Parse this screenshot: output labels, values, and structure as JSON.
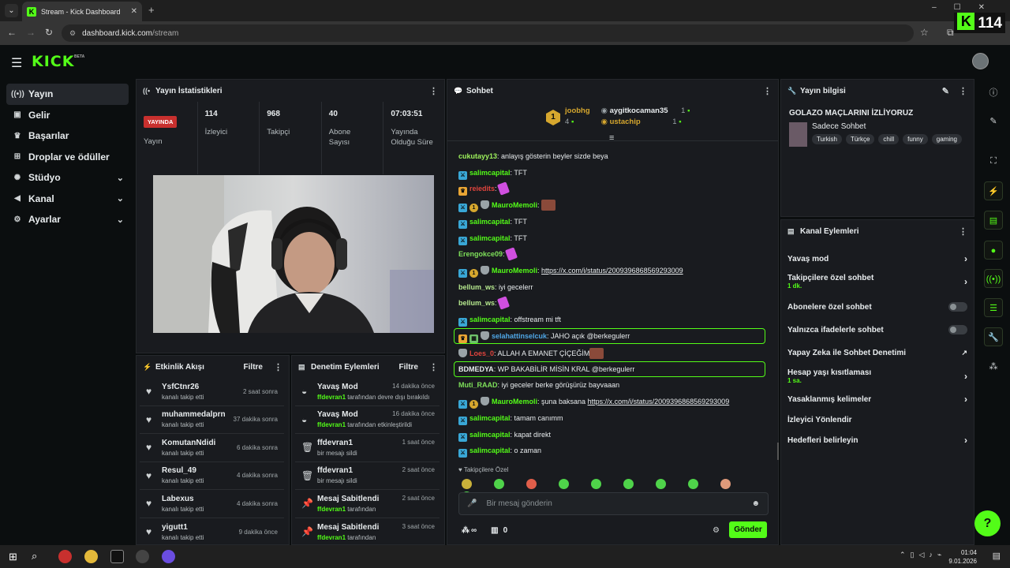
{
  "browser": {
    "tab_title": "Stream - Kick Dashboard",
    "url_host": "dashboard.kick.com",
    "url_path": "/stream",
    "viewer_overlay": "114"
  },
  "nav": {
    "items": [
      {
        "label": "Yayın",
        "icon": "broadcast-icon"
      },
      {
        "label": "Gelir",
        "icon": "wallet-icon"
      },
      {
        "label": "Başarılar",
        "icon": "trophy-icon"
      },
      {
        "label": "Droplar ve ödüller",
        "icon": "gift-icon"
      },
      {
        "label": "Stüdyo",
        "icon": "studio-icon"
      },
      {
        "label": "Kanal",
        "icon": "megaphone-icon"
      },
      {
        "label": "Ayarlar",
        "icon": "gear-icon"
      }
    ]
  },
  "stats": {
    "title": "Yayın İstatistikleri",
    "live_label": "YAYINDA",
    "live_sub": "Yayın",
    "viewers": "114",
    "viewers_label": "İzleyici",
    "followers": "968",
    "followers_label": "Takipçi",
    "subs": "40",
    "subs_label": "Abone Sayısı",
    "uptime": "07:03:51",
    "uptime_label": "Yayında Olduğu Süre"
  },
  "activity": {
    "title": "Etkinlik Akışı",
    "filter": "Filtre",
    "items": [
      {
        "name": "YsfCtnr26",
        "sub": "kanalı takip etti",
        "time": "2 saat sonra"
      },
      {
        "name": "muhammedalprn",
        "sub": "kanalı takip etti",
        "time": "37 dakika sonra"
      },
      {
        "name": "KomutanNdidi",
        "sub": "kanalı takip etti",
        "time": "6 dakika sonra"
      },
      {
        "name": "Resul_49",
        "sub": "kanalı takip etti",
        "time": "4 dakika sonra"
      },
      {
        "name": "Labexus",
        "sub": "kanalı takip etti",
        "time": "4 dakika sonra"
      },
      {
        "name": "yigutt1",
        "sub": "kanalı takip etti",
        "time": "9 dakika önce"
      }
    ]
  },
  "moderation": {
    "title": "Denetim Eylemleri",
    "filter": "Filtre",
    "items": [
      {
        "name": "Yavaş Mod",
        "actor": "ffdevran1",
        "sub": " tarafından devre dışı bırakıldı",
        "time": "14 dakika önce"
      },
      {
        "name": "Yavaş Mod",
        "actor": "ffdevran1",
        "sub": " tarafından etkinleştirildi",
        "time": "16 dakika önce"
      },
      {
        "name": "ffdevran1",
        "actor": "",
        "sub": "bir mesajı sildi",
        "time": "1 saat önce"
      },
      {
        "name": "ffdevran1",
        "actor": "",
        "sub": "bir mesajı sildi",
        "time": "2 saat önce"
      },
      {
        "name": "Mesaj Sabitlendi",
        "actor": "ffdevran1",
        "sub": " tarafından",
        "time": "2 saat önce"
      },
      {
        "name": "Mesaj Sabitlendi",
        "actor": "ffdevran1",
        "sub": " tarafından",
        "time": "3 saat önce"
      }
    ]
  },
  "chat": {
    "title": "Sohbet",
    "top_gifters": [
      {
        "name": "joobhg",
        "count": "4"
      },
      {
        "name": "aygitkocaman35",
        "count": "1"
      },
      {
        "name": "ustachip",
        "count": "1"
      }
    ],
    "top_rank": "1",
    "messages": [
      {
        "user": "cukutayy13",
        "text": ": anlayış gösterin beyler sizde beya"
      },
      {
        "user": "salimcapital",
        "text": ": TFT"
      },
      {
        "user": "reiedits",
        "text": ":"
      },
      {
        "user": "MauroMemoli",
        "text": ":"
      },
      {
        "user": "salimcapital",
        "text": ": TFT"
      },
      {
        "user": "salimcapital",
        "text": ": TFT"
      },
      {
        "user": "Erengokce09",
        "text": ":"
      },
      {
        "user": "MauroMemoli",
        "text": ": ",
        "link": "https://x.com/i/status/2009396868569293009"
      },
      {
        "user": "bellum_ws",
        "text": ": iyi gecelerr"
      },
      {
        "user": "bellum_ws",
        "text": ":"
      },
      {
        "user": "salimcapital",
        "text": ": offstream mi tft"
      },
      {
        "user": "selahattinselcuk",
        "text": ": JAHO açık @berkegulerr"
      },
      {
        "user": "Loes_0",
        "text": ": ALLAH A EMANET ÇİÇEĞİM"
      },
      {
        "user": "BDMEDYA",
        "text": ": WP BAKABİLİR MİSİN KRAL @berkegulerr"
      },
      {
        "user": "Muti_RAAD",
        "text": ": iyi geceler berke görüşürüz bayvaaan"
      },
      {
        "user": "MauroMemoli",
        "text": ": şuna baksana ",
        "link": "https://x.com/i/status/2009396868569293009"
      },
      {
        "user": "salimcapital",
        "text": ": tamam canımm"
      },
      {
        "user": "salimcapital",
        "text": ": kapat direkt"
      },
      {
        "user": "salimcapital",
        "text": ": o zaman"
      }
    ],
    "mode_label": "Takipçilere Özel",
    "input_placeholder": "Bir mesaj gönderin",
    "infinity": "∞",
    "points": "0",
    "send_label": "Gönder"
  },
  "stream_info": {
    "title": "Yayın bilgisi",
    "stream_title": "GOLAZO MAÇLARINI İZLİYORUZ",
    "category": "Sadece Sohbet",
    "tags": [
      "Turkish",
      "Türkçe",
      "chill",
      "funny",
      "gaming"
    ]
  },
  "channel_actions": {
    "title": "Kanal Eylemleri",
    "items": [
      {
        "label": "Yavaş mod",
        "sub": "",
        "control": "chevron"
      },
      {
        "label": "Takipçilere özel sohbet",
        "sub": "1 dk.",
        "control": "chevron"
      },
      {
        "label": "Abonelere özel sohbet",
        "sub": "",
        "control": "toggle"
      },
      {
        "label": "Yalnızca ifadelerle sohbet",
        "sub": "",
        "control": "toggle"
      },
      {
        "label": "Yapay Zeka ile Sohbet Denetimi",
        "sub": "",
        "control": "external"
      },
      {
        "label": "Hesap yaşı kısıtlaması",
        "sub": "1 sa.",
        "control": "chevron"
      },
      {
        "label": "Yasaklanmış kelimeler",
        "sub": "",
        "control": "chevron"
      },
      {
        "label": "İzleyici Yönlendir",
        "sub": "",
        "control": "none"
      },
      {
        "label": "Hedefleri belirleyin",
        "sub": "",
        "control": "chevron"
      }
    ]
  },
  "taskbar": {
    "time": "01:04",
    "date": "9.01.2026"
  },
  "colors": {
    "accent": "#53fc18",
    "live": "#c8302e",
    "panel": "#191b1f"
  }
}
